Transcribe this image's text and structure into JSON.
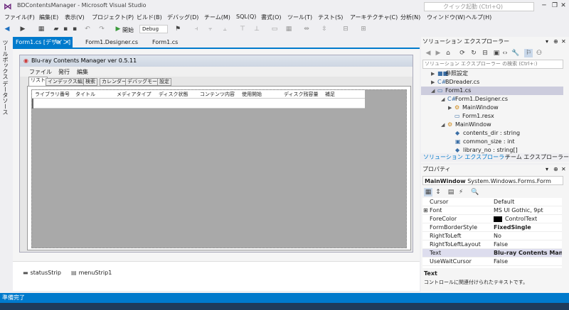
{
  "window": {
    "title": "BDContentsManager - Microsoft Visual Studio",
    "quick_launch_placeholder": "クイック起動 (Ctrl+Q)",
    "minimize": "─",
    "restore": "❐",
    "close": "✕"
  },
  "menu": [
    "ファイル(F)",
    "編集(E)",
    "表示(V)",
    "プロジェクト(P)",
    "ビルド(B)",
    "デバッグ(D)",
    "チーム(M)",
    "SQL(Q)",
    "書式(O)",
    "ツール(T)",
    "テスト(S)",
    "アーキテクチャ(C)",
    "分析(N)",
    "ウィンドウ(W)",
    "ヘルプ(H)"
  ],
  "toolbar": {
    "start_label": "開始",
    "config_value": "Debug"
  },
  "side_tabs": [
    "ツールボックス",
    "データソース"
  ],
  "doc_tabs": [
    {
      "label": "Form1.cs [デザイン]",
      "active": true
    },
    {
      "label": "Form1.Designer.cs",
      "active": false
    },
    {
      "label": "Form1.cs",
      "active": false
    }
  ],
  "doc_tab_pin": "⊕",
  "doc_tab_close": "✕",
  "form": {
    "title": "Blu-ray Contents Manager ver 0.5.11",
    "menu": [
      "ファイル",
      "発行",
      "編集"
    ],
    "tabs": [
      "リスト",
      "インデックス編集",
      "検索",
      "カレンダー",
      "デバッグモード",
      "設定"
    ],
    "columns": [
      "ライブラリ番号",
      "タイトル",
      "メディアタイプ",
      "ディスク状態",
      "コンテンツ内容",
      "使用開始",
      "ディスク残容量",
      "補足"
    ]
  },
  "component_tray": [
    "statusStrip",
    "menuStrip1"
  ],
  "solution_explorer": {
    "title": "ソリューション エクスプローラー",
    "search_placeholder": "ソリューション エクスプローラー の検索 (Ctrl+:)",
    "items": [
      {
        "label": "参照設定",
        "icon": "■■",
        "arrow": "▶"
      },
      {
        "label": "BDreader.cs",
        "icon": "C#",
        "arrow": "▶"
      },
      {
        "label": "Form1.cs",
        "icon": "▭",
        "arrow": "◢"
      },
      {
        "label": "Form1.Designer.cs",
        "icon": "C#",
        "arrow": "◢"
      },
      {
        "label": "MainWindow",
        "icon": "⚙",
        "arrow": "▶"
      },
      {
        "label": "Form1.resx",
        "icon": "▭",
        "arrow": ""
      },
      {
        "label": "MainWindow",
        "icon": "⚙",
        "arrow": "◢"
      },
      {
        "label": "contents_dir : string",
        "icon": "◆",
        "arrow": ""
      },
      {
        "label": "common_size : int",
        "icon": "▣",
        "arrow": ""
      },
      {
        "label": "library_no : string[]",
        "icon": "◆",
        "arrow": ""
      }
    ],
    "bottom_tabs": [
      "ソリューション エクスプローラー",
      "チーム エクスプローラー"
    ]
  },
  "properties": {
    "title": "プロパティ",
    "object_name": "MainWindow",
    "object_type": "System.Windows.Forms.Form",
    "rows": [
      {
        "name": "Cursor",
        "value": "Default",
        "bold": false,
        "expand": ""
      },
      {
        "name": "Font",
        "value": "MS UI Gothic, 9pt",
        "bold": false,
        "expand": "⊞"
      },
      {
        "name": "ForeColor",
        "value": "ControlText",
        "bold": false,
        "expand": ""
      },
      {
        "name": "FormBorderStyle",
        "value": "FixedSingle",
        "bold": true,
        "expand": ""
      },
      {
        "name": "RightToLeft",
        "value": "No",
        "bold": false,
        "expand": ""
      },
      {
        "name": "RightToLeftLayout",
        "value": "False",
        "bold": false,
        "expand": ""
      },
      {
        "name": "Text",
        "value": "Blu-ray Contents Manage",
        "bold": true,
        "expand": ""
      },
      {
        "name": "UseWaitCursor",
        "value": "False",
        "bold": false,
        "expand": ""
      }
    ],
    "desc_title": "Text",
    "desc_text": "コントロールに関連付けられたテキストです。"
  },
  "status": {
    "text": "準備完了"
  }
}
